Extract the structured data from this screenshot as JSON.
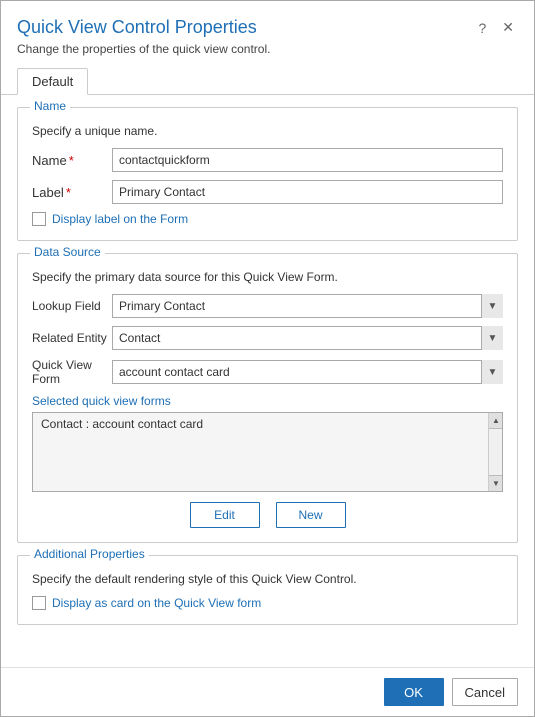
{
  "dialog": {
    "title": "Quick View Control Properties",
    "subtitle": "Change the properties of the quick view control.",
    "help_icon": "?",
    "close_icon": "✕"
  },
  "tabs": [
    {
      "label": "Default",
      "active": true
    }
  ],
  "name_section": {
    "legend": "Name",
    "desc": "Specify a unique name.",
    "name_label": "Name",
    "name_required": "*",
    "name_value": "contactquickform",
    "label_label": "Label",
    "label_required": "*",
    "label_value": "Primary Contact",
    "checkbox_label": "Display label on the Form"
  },
  "data_source_section": {
    "legend": "Data Source",
    "desc": "Specify the primary data source for this Quick View Form.",
    "lookup_field_label": "Lookup Field",
    "lookup_field_value": "Primary Contact",
    "lookup_options": [
      "Primary Contact"
    ],
    "related_entity_label": "Related Entity",
    "related_entity_value": "Contact",
    "related_entity_options": [
      "Contact"
    ],
    "quick_view_form_label": "Quick View Form",
    "quick_view_form_value": "account contact card",
    "quick_view_form_options": [
      "account contact card"
    ],
    "selected_forms_label": "Selected quick view forms",
    "selected_forms_item": "Contact : account contact card",
    "edit_button": "Edit",
    "new_button": "New"
  },
  "additional_section": {
    "legend": "Additional Properties",
    "desc": "Specify the default rendering style of this Quick View Control.",
    "checkbox_label": "Display as card on the Quick View form"
  },
  "footer": {
    "ok_label": "OK",
    "cancel_label": "Cancel"
  }
}
